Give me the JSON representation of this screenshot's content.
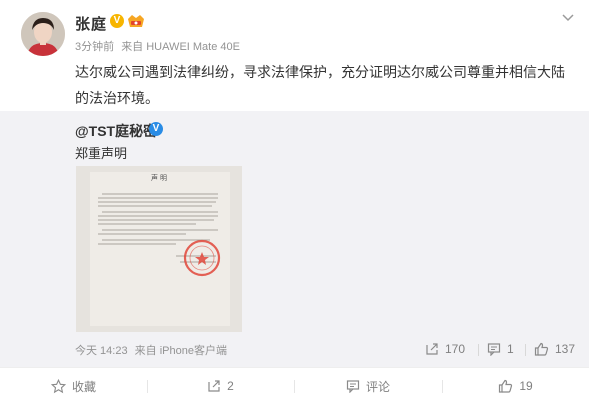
{
  "post": {
    "author": "张庭",
    "time": "3分钟前",
    "source": "来自 HUAWEI Mate 40E",
    "text": "达尔威公司遇到法律纠纷，寻求法律保护，充分证明达尔威公司尊重并相信大陆的法治环境。"
  },
  "repost": {
    "author": "@TST庭秘密",
    "text": "郑重声明",
    "image": {
      "heading": "声 明"
    },
    "time": "今天 14:23",
    "source": "来自 iPhone客户端",
    "stats": {
      "forwards": "170",
      "comments": "1",
      "likes": "137"
    }
  },
  "actions": {
    "favorite": "收藏",
    "forward": "2",
    "comment": "评论",
    "like": "19"
  },
  "colors": {
    "verified_yellow": "#f7b500",
    "verified_blue": "#2a8ce5",
    "repost_bg": "#f2f2f5",
    "stamp_red": "#e0463a"
  }
}
